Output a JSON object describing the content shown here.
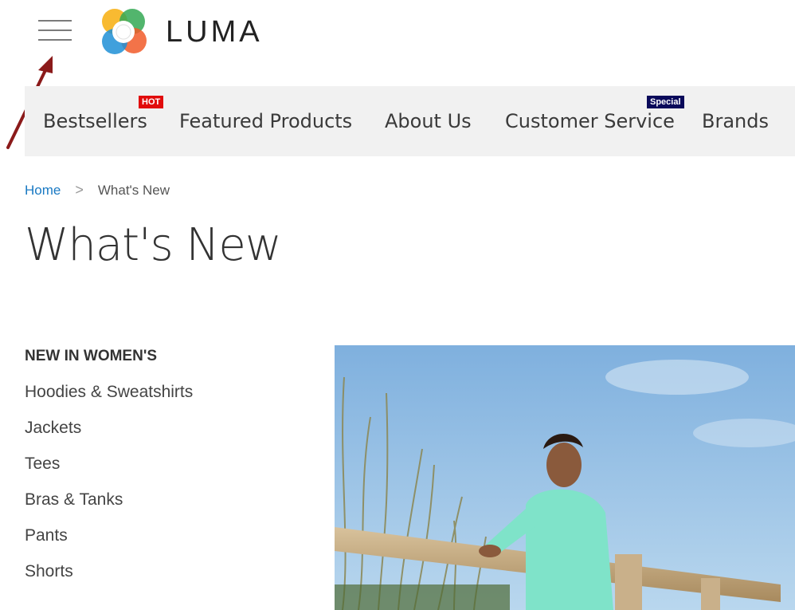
{
  "header": {
    "logo_text": "LUMA",
    "menu_icon": "hamburger-menu-icon",
    "logo_icon": "luma-logo-icon"
  },
  "nav": {
    "items": [
      {
        "label": "Bestsellers",
        "badge": "HOT"
      },
      {
        "label": "Featured Products"
      },
      {
        "label": "About Us"
      },
      {
        "label": "Customer Service",
        "badge": "Special"
      },
      {
        "label": "Brands"
      }
    ]
  },
  "breadcrumb": {
    "home": "Home",
    "separator": ">",
    "current": "What's New"
  },
  "page": {
    "title": "What's New"
  },
  "sidebar": {
    "heading": "NEW IN WOMEN'S",
    "items": [
      "Hoodies & Sweatshirts",
      "Jackets",
      "Tees",
      "Bras & Tanks",
      "Pants",
      "Shorts"
    ]
  },
  "colors": {
    "link": "#1979c3",
    "badge_hot": "#e10b0b",
    "badge_special": "#0a0a5a",
    "nav_bg": "#f1f1f1",
    "annotation_arrow": "#8b1a1a"
  }
}
